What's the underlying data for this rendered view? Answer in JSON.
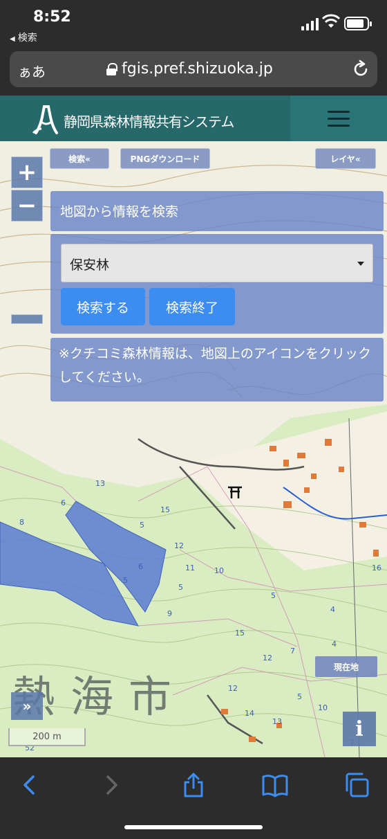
{
  "status_bar": {
    "time": "8:52",
    "back_label": "検索"
  },
  "browser": {
    "text_size_label": "ぁあ",
    "url": "fgis.pref.shizuoka.jp"
  },
  "site": {
    "title": "静岡県森林情報共有システム"
  },
  "map_toolbar": {
    "search_toggle": "検索«",
    "png_download": "PNGダウンロード",
    "layer_toggle": "レイヤ«"
  },
  "search_panel": {
    "title": "地図から情報を検索",
    "select_value": "保安林",
    "search_button": "検索する",
    "end_button": "検索終了",
    "note": "※クチコミ森林情報は、地図上のアイコンをクリックしてください。"
  },
  "map_controls": {
    "zoom_in": "+",
    "zoom_out": "−",
    "current_location": "現在地",
    "expand": "»",
    "info": "i",
    "scale_label": "200 m"
  },
  "map_labels": {
    "city": "熱海市",
    "contour_numbers": [
      "13",
      "6",
      "8",
      "15",
      "5",
      "12",
      "10",
      "5",
      "6",
      "9",
      "5",
      "11",
      "12",
      "15",
      "7",
      "5",
      "4",
      "12",
      "14",
      "13",
      "10",
      "5",
      "4",
      "16",
      "7",
      "52"
    ]
  },
  "colors": {
    "header_bg": "#1e6468",
    "panel_bg": "#6482c8",
    "button_blue": "#3d8df0",
    "protected_forest": "#5a7dd2"
  }
}
